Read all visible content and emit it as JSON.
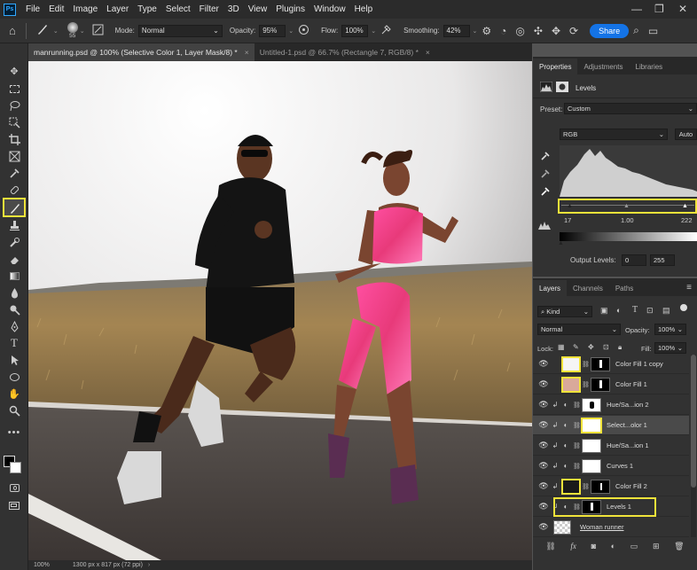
{
  "app": {
    "logo": "Ps"
  },
  "menu": [
    "File",
    "Edit",
    "Image",
    "Layer",
    "Type",
    "Select",
    "Filter",
    "3D",
    "View",
    "Plugins",
    "Window",
    "Help"
  ],
  "window_controls": {
    "minimize": "—",
    "restore": "❐",
    "close": "✕"
  },
  "options": {
    "brush_size": "55",
    "mode_label": "Mode:",
    "mode_value": "Normal",
    "opacity_label": "Opacity:",
    "opacity_value": "95%",
    "flow_label": "Flow:",
    "flow_value": "100%",
    "smoothing_label": "Smoothing:",
    "smoothing_value": "42%",
    "share_label": "Share"
  },
  "tabs": [
    {
      "label": "manrunning.psd @ 100% (Selective Color 1, Layer Mask/8) *",
      "active": true
    },
    {
      "label": "Untitled-1.psd @ 66.7% (Rectangle 7, RGB/8) *",
      "active": false
    }
  ],
  "tab_close": "×",
  "status": {
    "zoom": "100%",
    "doc_info": "1300 px x 817 px (72 ppi)"
  },
  "properties": {
    "tabs": [
      "Properties",
      "Adjustments",
      "Libraries"
    ],
    "adjustment_name": "Levels",
    "preset_label": "Preset:",
    "preset_value": "Custom",
    "channel_value": "RGB",
    "auto_label": "Auto",
    "input_values": [
      "17",
      "1.00",
      "222"
    ],
    "output_label": "Output Levels:",
    "output_values": [
      "0",
      "255"
    ]
  },
  "layers_panel": {
    "tabs": [
      "Layers",
      "Channels",
      "Paths"
    ],
    "filter_value": "Kind",
    "blend_value": "Normal",
    "opacity_label": "Opacity:",
    "opacity_value": "100%",
    "lock_label": "Lock:",
    "fill_label": "Fill:",
    "fill_value": "100%",
    "layers": [
      {
        "name": "Color Fill 1 copy"
      },
      {
        "name": "Color Fill 1"
      },
      {
        "name": "Hue/Sa...ion 2"
      },
      {
        "name": "Select...olor 1"
      },
      {
        "name": "Hue/Sa...ion 1"
      },
      {
        "name": "Curves 1"
      },
      {
        "name": "Color Fill 2"
      },
      {
        "name": "Levels 1"
      },
      {
        "name": "Woman runner"
      }
    ]
  },
  "colors": {
    "accent": "#1473e6",
    "highlight": "#f0e33a",
    "fill1_swatch": "#d9a99a",
    "fill2_swatch": "#1a1a1a"
  }
}
